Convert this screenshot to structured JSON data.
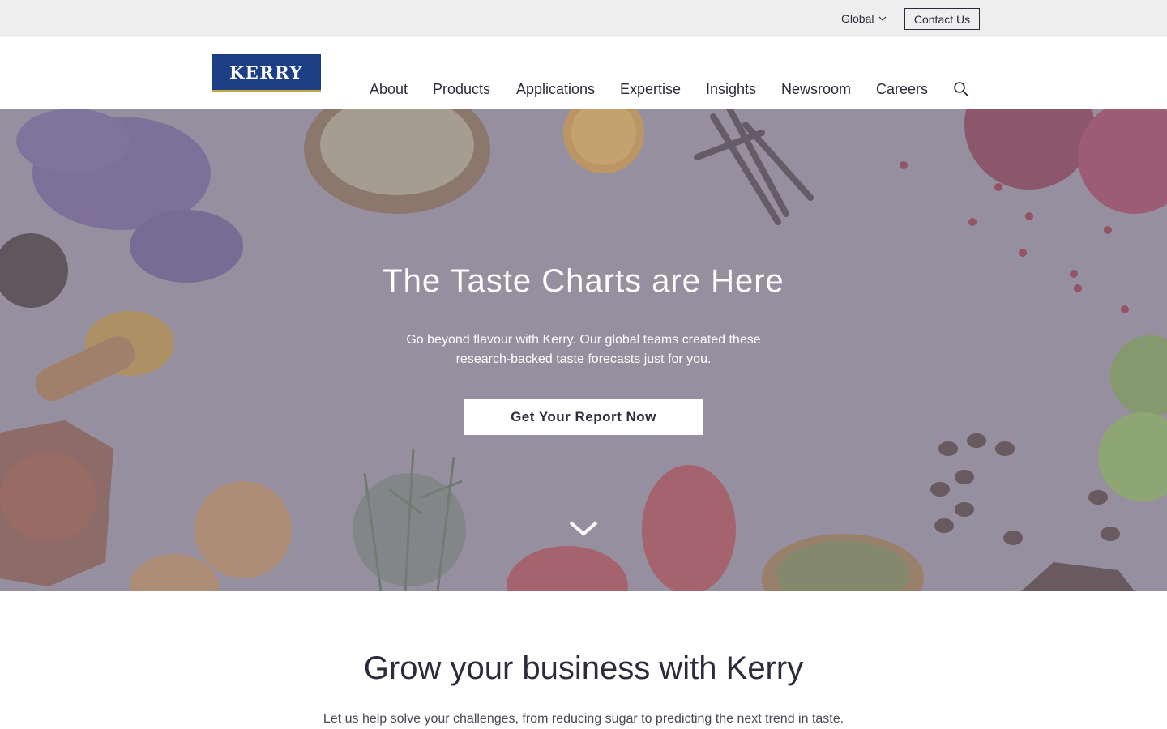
{
  "utility": {
    "region_label": "Global",
    "contact_label": "Contact Us"
  },
  "header": {
    "logo_text": "KERRY",
    "nav": [
      "About",
      "Products",
      "Applications",
      "Expertise",
      "Insights",
      "Newsroom",
      "Careers"
    ],
    "search_icon": "search-icon"
  },
  "hero": {
    "title": "The Taste Charts are Here",
    "subtitle": "Go beyond flavour with Kerry. Our global teams created these research-backed taste forecasts just for you.",
    "cta_label": "Get Your Report Now",
    "scroll_icon": "chevron-down-icon"
  },
  "section": {
    "title": "Grow your business with Kerry",
    "text": "Let us help solve your challenges, from reducing sugar to predicting the next trend in taste."
  },
  "colors": {
    "brand_blue": "#1c3f86",
    "brand_gold": "#c7a648",
    "text_dark": "#2d2a3b",
    "utility_bg": "#efeeef",
    "hero_overlay": "#8e8898"
  }
}
